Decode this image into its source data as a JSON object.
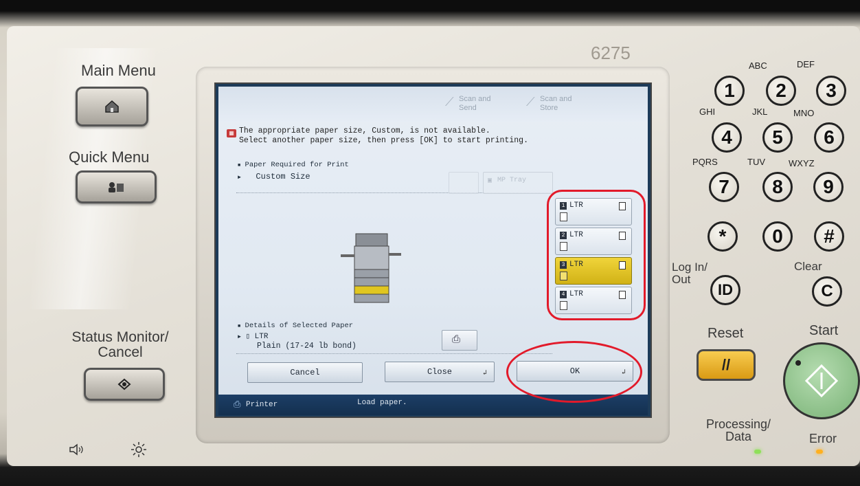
{
  "device": {
    "model_partial": "6275",
    "left_buttons": {
      "main_menu": "Main Menu",
      "quick_menu": "Quick Menu",
      "status_monitor": "Status Monitor/\nCancel"
    },
    "keypad": {
      "keys": [
        "1",
        "2",
        "3",
        "4",
        "5",
        "6",
        "7",
        "8",
        "9",
        "*",
        "0",
        "#"
      ],
      "letters": [
        "ABC",
        "DEF",
        "GHI",
        "JKL",
        "MNO",
        "PQRS",
        "TUV",
        "WXYZ"
      ],
      "login_label": "Log In/\nOut",
      "login_key": "ID",
      "clear_label": "Clear",
      "clear_key": "C",
      "reset_label": "Reset",
      "start_label": "Start",
      "processing_label": "Processing/\nData",
      "error_label": "Error"
    }
  },
  "screen": {
    "tabs": [
      {
        "label": "Scan and\nSend"
      },
      {
        "label": "Scan and\nStore"
      }
    ],
    "message": {
      "line1": "The appropriate paper size, Custom, is not available.",
      "line2": "Select another paper size, then press [OK] to start printing."
    },
    "paper_required": {
      "heading": "Paper Required for Print",
      "value": "Custom Size",
      "mp_tray": "MP Tray"
    },
    "trays": [
      {
        "number": "1",
        "size": "LTR",
        "selected": false
      },
      {
        "number": "2",
        "size": "LTR",
        "selected": false
      },
      {
        "number": "3",
        "size": "LTR",
        "selected": true
      },
      {
        "number": "4",
        "size": "LTR",
        "selected": false
      }
    ],
    "details": {
      "heading": "Details of Selected Paper",
      "size": "LTR",
      "type": "Plain (17-24 lb bond)"
    },
    "buttons": {
      "cancel": "Cancel",
      "close": "Close",
      "ok": "OK"
    },
    "status_bar": {
      "app": "Printer",
      "message": "Load paper."
    }
  },
  "colors": {
    "highlight_annotation": "#e21a2a",
    "selected_tray": "#d9bc1c",
    "status_bar": "#1a3a5e"
  }
}
